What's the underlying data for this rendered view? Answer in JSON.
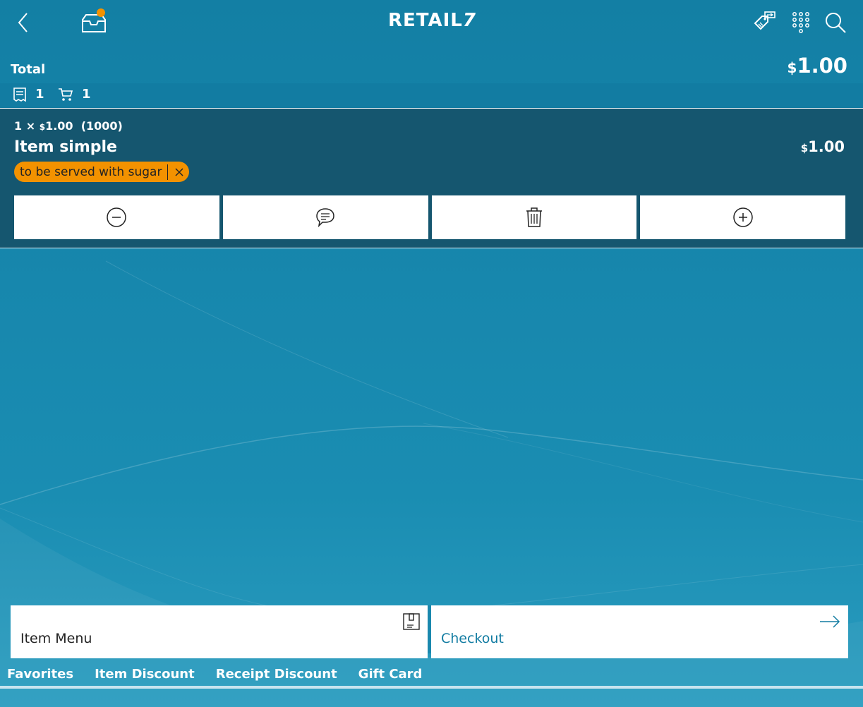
{
  "app": {
    "logo_text": "RETAIL",
    "logo_number": "7"
  },
  "header": {
    "icons": [
      "chevron-left-icon",
      "inbox-icon",
      "price-tag-icon",
      "keypad-icon",
      "search-icon"
    ],
    "notification_color": "#f39200"
  },
  "summary": {
    "total_label": "Total",
    "total_currency": "$",
    "total_amount": "1.00",
    "receipt_count": "1",
    "cart_count": "1"
  },
  "line_item": {
    "quantity": "1",
    "times_symbol": "×",
    "unit_currency": "$",
    "unit_price": "1.00",
    "item_code": "(1000)",
    "name": "Item simple",
    "price_currency": "$",
    "price": "1.00",
    "comment": "to be served with sugar",
    "actions": [
      "decrease-quantity",
      "add-comment",
      "delete-item",
      "increase-quantity"
    ]
  },
  "tiles": {
    "item_menu_label": "Item Menu",
    "checkout_label": "Checkout"
  },
  "tabs": [
    {
      "label": "Favorites"
    },
    {
      "label": "Item Discount"
    },
    {
      "label": "Receipt Discount"
    },
    {
      "label": "Gift Card"
    }
  ],
  "colors": {
    "accent_orange": "#f39200",
    "background_blue": "#137fa4",
    "line_item_bg": "#15566f",
    "checkout_text": "#127ca2"
  }
}
